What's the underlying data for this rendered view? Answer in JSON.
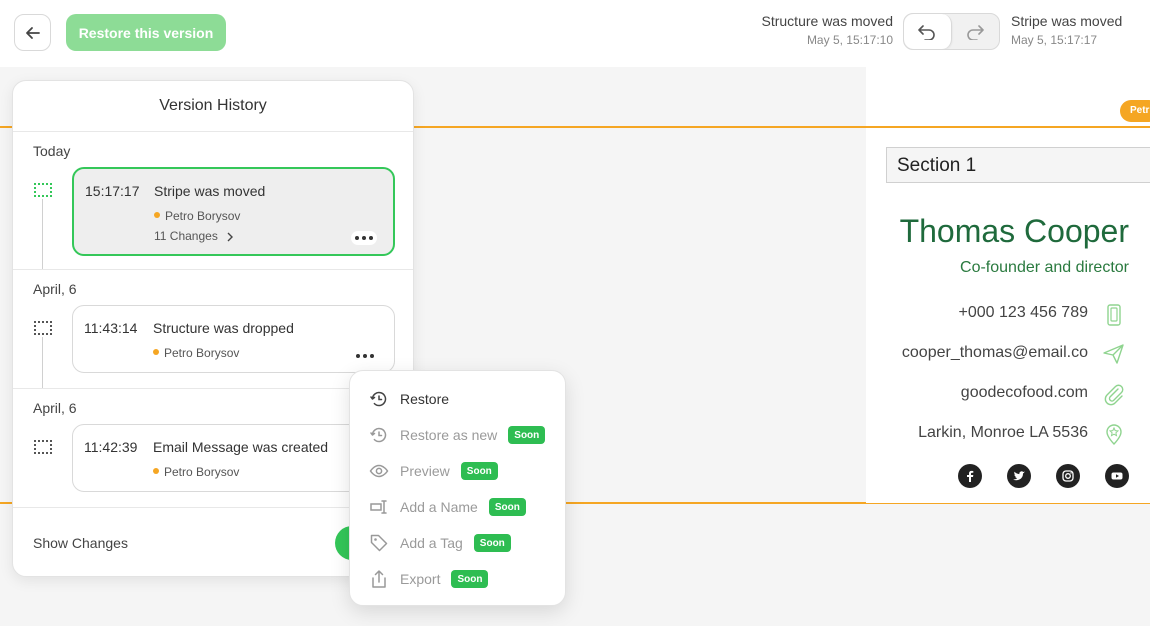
{
  "topbar": {
    "restore_label": "Restore this version",
    "undo_label": "Structure was moved",
    "undo_time": "May 5, 15:17:10",
    "redo_label": "Stripe was moved",
    "redo_time": "May 5, 15:17:17"
  },
  "version_history": {
    "title": "Version History",
    "groups": [
      {
        "label": "Today",
        "entry": {
          "time": "15:17:17",
          "event": "Stripe was moved",
          "author": "Petro Borysov",
          "changes": "11 Changes"
        }
      },
      {
        "label": "April, 6",
        "entry": {
          "time": "11:43:14",
          "event": "Structure was dropped",
          "author": "Petro Borysov"
        }
      },
      {
        "label": "April, 6",
        "entry": {
          "time": "11:42:39",
          "event": "Email Message was created",
          "author": "Petro Borysov"
        }
      }
    ],
    "footer_label": "Show Changes"
  },
  "context_menu": {
    "soon_label": "Soon",
    "items": [
      {
        "label": "Restore",
        "icon": "restore-icon",
        "soon": false
      },
      {
        "label": "Restore as new",
        "icon": "restore-as-new-icon",
        "soon": true
      },
      {
        "label": "Preview",
        "icon": "eye-icon",
        "soon": true
      },
      {
        "label": "Add a Name",
        "icon": "rename-icon",
        "soon": true
      },
      {
        "label": "Add a Tag",
        "icon": "tag-icon",
        "soon": true
      },
      {
        "label": "Export",
        "icon": "share-icon",
        "soon": true
      }
    ]
  },
  "canvas": {
    "author_tag": "Petr",
    "section_label": "Section 1",
    "signature": {
      "name": "Thomas Cooper",
      "role": "Co-founder and director",
      "phone": "+000 123 456 789",
      "email": "cooper_thomas@email.co",
      "website": "goodecofood.com",
      "address": "Larkin, Monroe LA 5536"
    },
    "socials": [
      "facebook-icon",
      "twitter-icon",
      "instagram-icon",
      "youtube-icon"
    ]
  },
  "colors": {
    "accent_green": "#34c759",
    "stripe_orange": "#f5a623",
    "signature_green": "#1f6a3c"
  }
}
